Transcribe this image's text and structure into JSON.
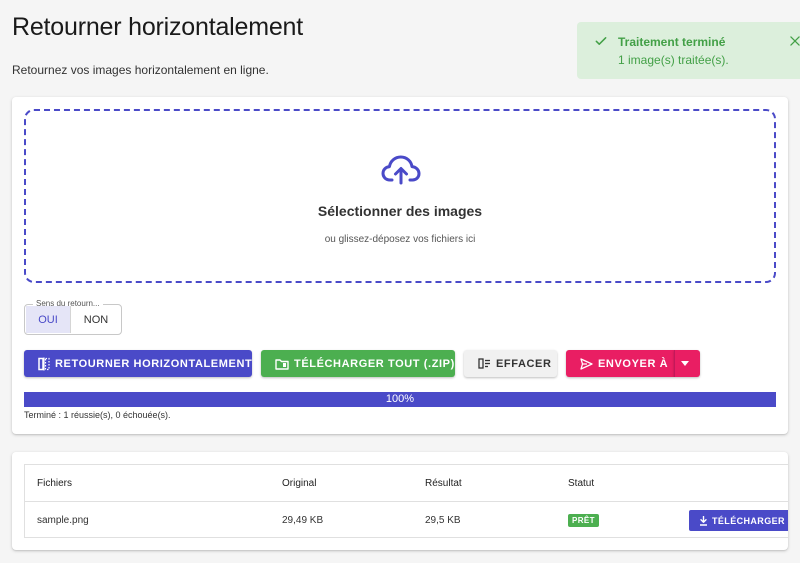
{
  "page": {
    "title": "Retourner horizontalement",
    "subtitle": "Retournez vos images horizontalement en ligne."
  },
  "toast": {
    "title": "Traitement terminé",
    "message": "1 image(s) traitée(s).",
    "icon": "check-icon",
    "close_icon": "close-icon",
    "color": "#43a047"
  },
  "dropzone": {
    "icon": "cloud-upload-icon",
    "title": "Sélectionner des images",
    "hint": "ou glissez-déposez vos fichiers ici"
  },
  "direction_toggle": {
    "legend": "Sens du retourn...",
    "options": [
      "OUI",
      "NON"
    ],
    "selected": "OUI"
  },
  "actions": {
    "flip_label": "RETOURNER HORIZONTALEMENT",
    "download_all_label": "TÉLÉCHARGER TOUT (.ZIP)",
    "clear_label": "EFFACER",
    "send_label": "ENVOYER À"
  },
  "progress": {
    "percent_label": "100%",
    "value": 1.0,
    "status": "Terminé : 1 réussie(s), 0 échouée(s)."
  },
  "files_table": {
    "headers": [
      "Fichiers",
      "Original",
      "Résultat",
      "Statut"
    ],
    "rows": [
      {
        "name": "sample.png",
        "original": "29,49 KB",
        "result": "29,5 KB",
        "status": "PRÊT",
        "download_label": "TÉLÉCHARGER"
      }
    ]
  },
  "colors": {
    "primary": "#4a4ac8",
    "success": "#4caf50",
    "accent": "#e91e63"
  }
}
